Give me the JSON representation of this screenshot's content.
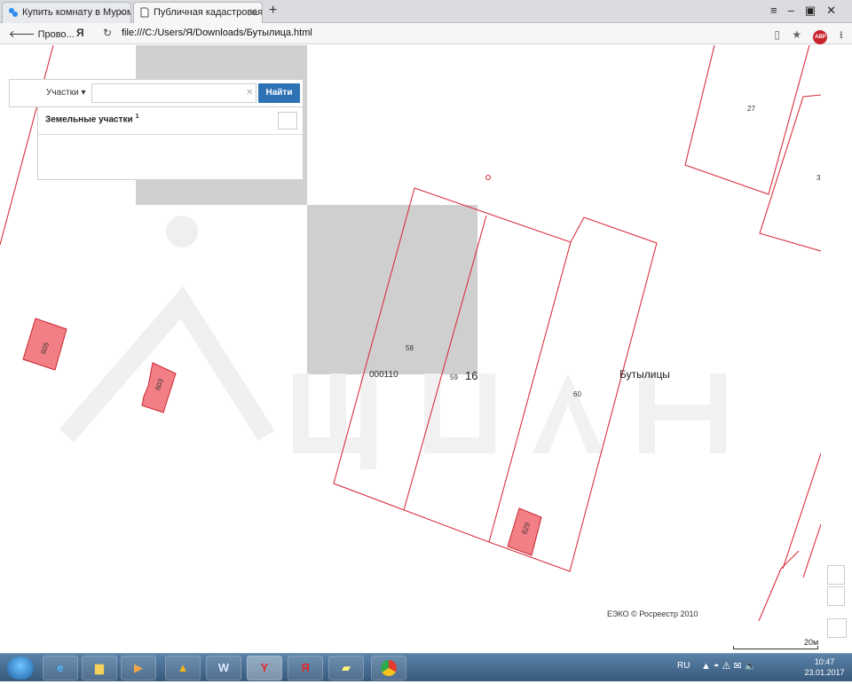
{
  "browser": {
    "tabs": [
      {
        "title": "Купить комнату в Муроме",
        "icon": "cian-icon"
      },
      {
        "title": "Публичная кадастровая",
        "icon": "page-icon"
      }
    ],
    "back_label": "Прово...",
    "brand_letter": "Я",
    "url": "file:///C:/Users/Я/Downloads/Бутылица.html",
    "abp_label": "ABP"
  },
  "search": {
    "filter_label": "Участки",
    "input_value": "",
    "button_label": "Найти"
  },
  "results": {
    "title": "Земельные участки",
    "count": "1"
  },
  "map": {
    "plots": [
      "27",
      "58",
      "59",
      "60",
      "3"
    ],
    "buildings": [
      "605",
      "603",
      "629"
    ],
    "block_number": "000110",
    "quarter_number": "16",
    "village_name": "Бутылицы",
    "attribution": "ЕЭКО © Росреестр 2010",
    "scale_label": "20м",
    "colors": {
      "boundary": "#d9303f",
      "building_fill": "#f37f86",
      "raster_gray": "#cfcfcf",
      "watermark": "#eeeeee"
    }
  },
  "taskbar": {
    "apps": [
      "ie-icon",
      "explorer-icon",
      "media-icon",
      "aimp-icon",
      "word-icon",
      "yandex-browser-icon",
      "yandex-icon",
      "notes-icon",
      "chrome-icon"
    ],
    "language": "RU",
    "time": "10:47",
    "date": "23.01.2017"
  }
}
